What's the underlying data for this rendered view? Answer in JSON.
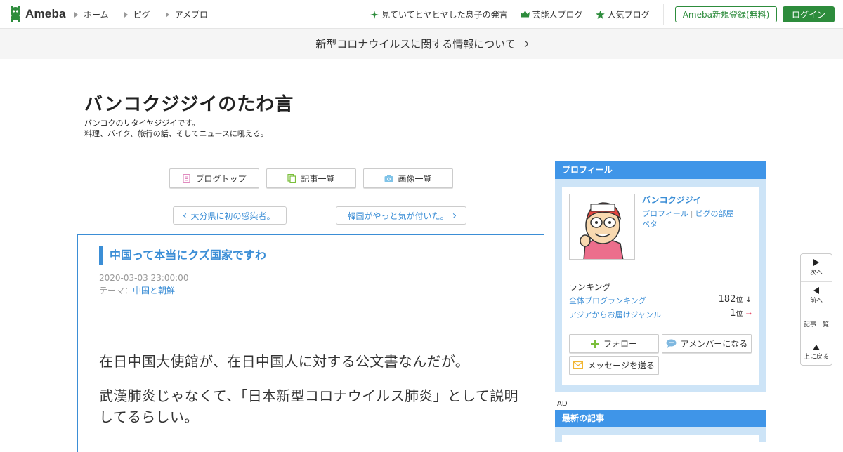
{
  "header": {
    "logo_text": "Ameba",
    "nav": [
      "ホーム",
      "ピグ",
      "アメブロ"
    ],
    "hot_links": [
      {
        "label": "見ていてヒヤヒヤした息子の発言",
        "icon": "sparkle-icon"
      },
      {
        "label": "芸能人ブログ",
        "icon": "crown-icon"
      },
      {
        "label": "人気ブログ",
        "icon": "star-icon"
      }
    ],
    "register_label": "Ameba新規登録(無料)",
    "login_label": "ログイン",
    "brand_color": "#2d8c3c"
  },
  "notice": {
    "text": "新型コロナウイルスに関する情報について"
  },
  "blog": {
    "title": "バンコクジジイのたわ言",
    "desc_line1": "バンコクのリタイヤジジイです。",
    "desc_line2": "料理、バイク、旅行の話、そしてニュースに吼える。"
  },
  "tabs": [
    {
      "label": "ブログトップ",
      "icon": "document-icon"
    },
    {
      "label": "記事一覧",
      "icon": "copy-icon"
    },
    {
      "label": "画像一覧",
      "icon": "camera-icon"
    }
  ],
  "pager": {
    "prev_label": "大分県に初の感染者。",
    "next_label": "韓国がやっと気が付いた。"
  },
  "article": {
    "title": "中国って本当にクズ国家ですわ",
    "date": "2020-03-03 23:00:00",
    "theme_prefix": "テーマ：",
    "theme": "中国と朝鮮",
    "p1": "在日中国大使館が、在日中国人に対する公文書なんだが。",
    "p2": "武漢肺炎じゃなくて、「日本新型コロナウイルス肺炎」として説明してるらしい。",
    "accent_color": "#3b8ed6"
  },
  "profile": {
    "heading": "プロフィール",
    "name": "バンコクジジイ",
    "link_profile": "プロフィール",
    "link_pig": "ピグの部屋",
    "badge": "ペタ",
    "ranking_heading": "ランキング",
    "rankings": [
      {
        "label": "全体ブログランキング",
        "value": "182",
        "unit": "位",
        "trend": "↓"
      },
      {
        "label": "アジアからお届けジャンル",
        "value": "1",
        "unit": "位",
        "trend": "→"
      }
    ],
    "follow_label": "フォロー",
    "amember_label": "アメンバーになる",
    "message_label": "メッセージを送る"
  },
  "ad_label": "AD",
  "latest": {
    "heading": "最新の記事"
  },
  "float_nav": {
    "next": "次へ",
    "prev": "前へ",
    "list": "記事一覧",
    "top": "上に戻る"
  }
}
